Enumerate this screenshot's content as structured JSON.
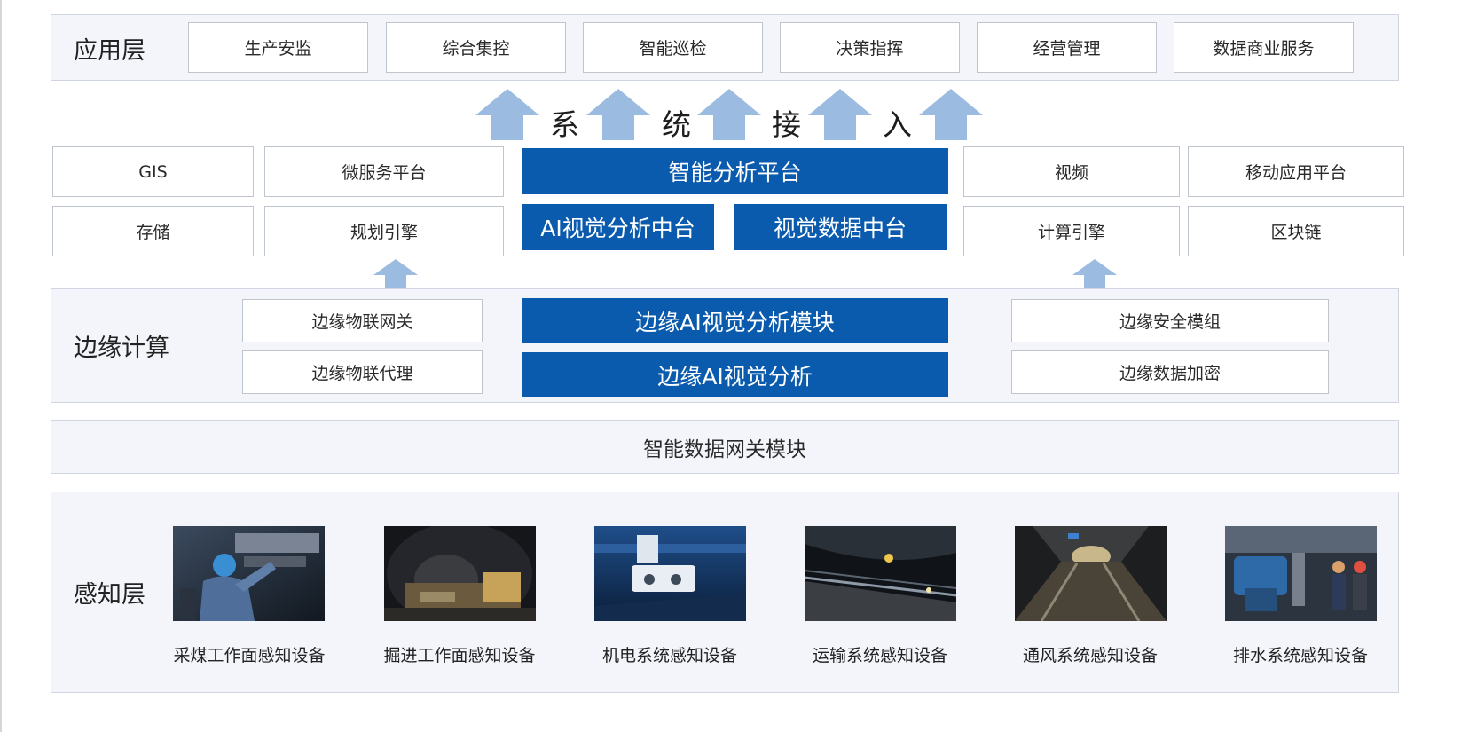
{
  "colors": {
    "accent_blue": "#0a5bad",
    "arrow_blue": "#9bbbe0",
    "band_bg": "#f3f5fa"
  },
  "app_layer": {
    "label": "应用层",
    "items": [
      "生产安监",
      "综合集控",
      "智能巡检",
      "决策指挥",
      "经营管理",
      "数据商业服务"
    ]
  },
  "system_access": {
    "chars": [
      "系",
      "统",
      "接",
      "入"
    ]
  },
  "platform": {
    "left_top": [
      "GIS",
      "微服务平台"
    ],
    "left_bottom": [
      "存储",
      "规划引擎"
    ],
    "center_title": "智能分析平台",
    "center_left": "AI视觉分析中台",
    "center_right": "视觉数据中台",
    "right_top": [
      "视频",
      "移动应用平台"
    ],
    "right_bottom": [
      "计算引擎",
      "区块链"
    ]
  },
  "edge": {
    "label": "边缘计算",
    "left": [
      "边缘物联网关",
      "边缘物联代理"
    ],
    "center": [
      "边缘AI视觉分析模块",
      "边缘AI视觉分析"
    ],
    "right": [
      "边缘安全模组",
      "边缘数据加密"
    ]
  },
  "gateway": {
    "label": "智能数据网关模块"
  },
  "perception": {
    "label": "感知层",
    "devices": [
      "采煤工作面感知设备",
      "掘进工作面感知设备",
      "机电系统感知设备",
      "运输系统感知设备",
      "通风系统感知设备",
      "排水系统感知设备"
    ]
  }
}
